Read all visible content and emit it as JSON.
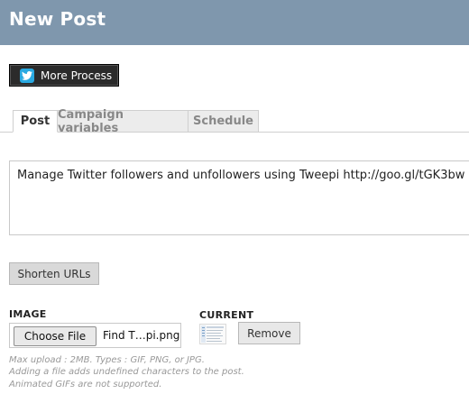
{
  "header": {
    "title": "New Post"
  },
  "twitter_button": {
    "label": "More Process",
    "icon": "twitter-bird-icon",
    "icon_color": "#29a9e1"
  },
  "tabs": [
    {
      "label": "Post",
      "active": true
    },
    {
      "label": "Campaign variables",
      "active": false
    },
    {
      "label": "Schedule",
      "active": false
    }
  ],
  "message": {
    "text": "Manage Twitter followers and unfollowers using Tweepi http://goo.gl/tGK3bw"
  },
  "shorten_button": {
    "label": "Shorten URLs"
  },
  "image": {
    "label": "IMAGE",
    "choose_label": "Choose File",
    "file_name": "Find T…pi.png"
  },
  "current": {
    "label": "CURRENT",
    "thumbnail_icon": "image-thumbnail-icon",
    "remove_label": "Remove"
  },
  "help": {
    "line1": "Max upload : 2MB. Types : GIF, PNG, or JPG.",
    "line2": "Adding a file adds undefined characters to the post.",
    "line3": "Animated GIFs are not supported."
  },
  "colors": {
    "header_bg": "#7f97ad",
    "button_dark": "#2b2b2b"
  }
}
